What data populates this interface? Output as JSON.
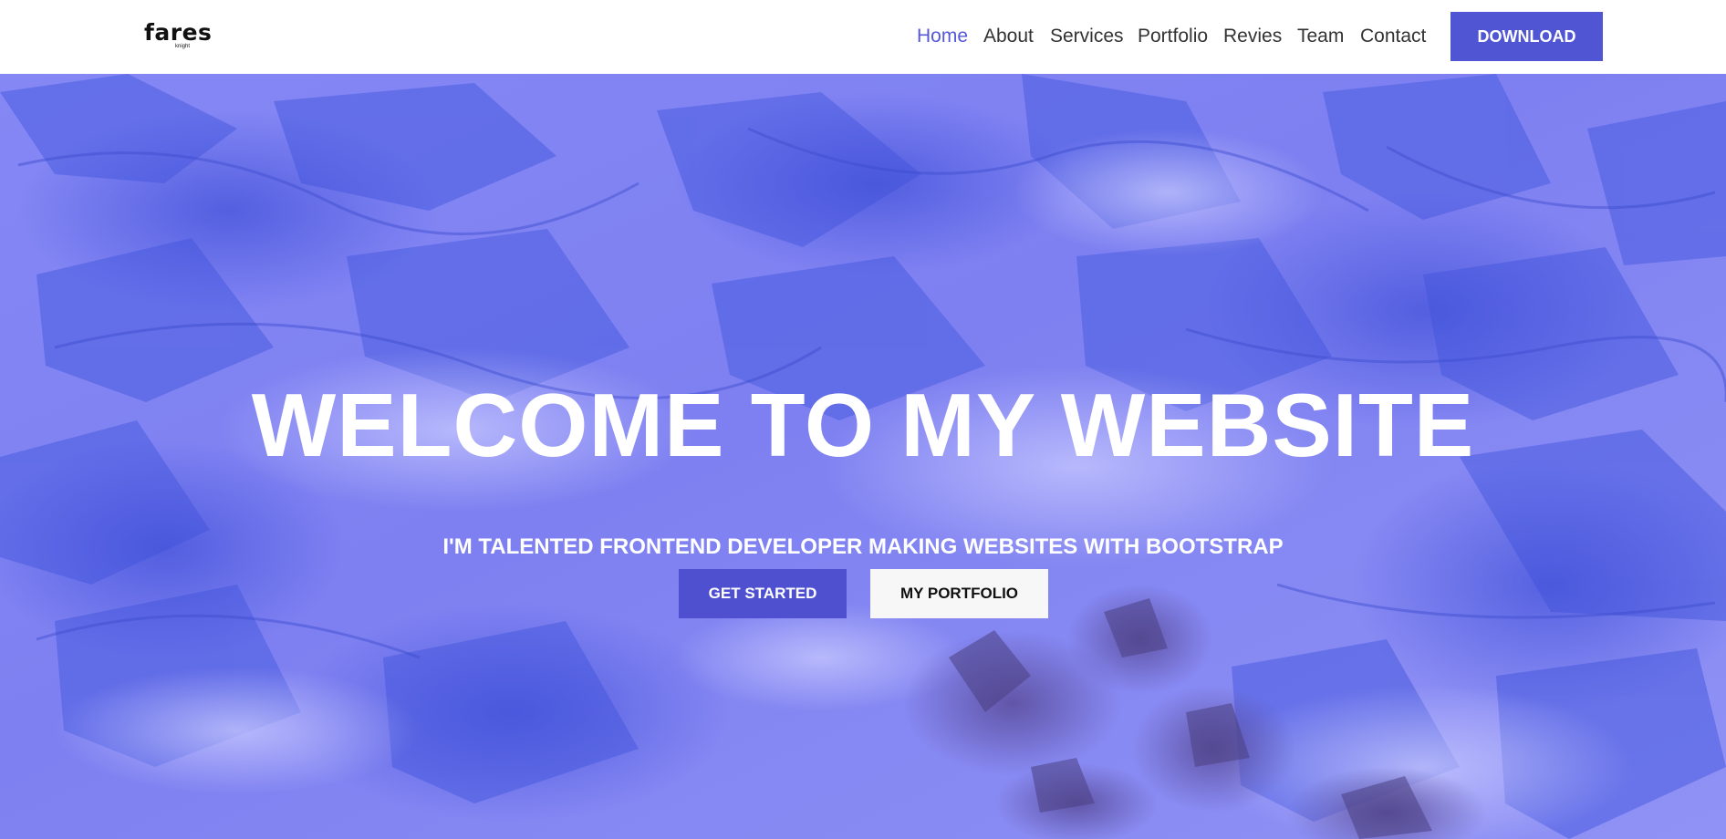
{
  "brand": {
    "name": "fares",
    "tagline": "knight"
  },
  "nav": {
    "items": [
      {
        "label": "Home",
        "active": true
      },
      {
        "label": "About",
        "active": false
      },
      {
        "label": "Services",
        "active": false
      },
      {
        "label": "Portfolio",
        "active": false
      },
      {
        "label": "Revies",
        "active": false
      },
      {
        "label": "Team",
        "active": false
      },
      {
        "label": "Contact",
        "active": false
      }
    ],
    "download_label": "DOWNLOAD"
  },
  "hero": {
    "title": "WELCOME TO MY WEBSITE",
    "subtitle": "I'M TALENTED FRONTEND DEVELOPER MAKING WEBSITES WITH BOOTSTRAP",
    "primary_button": "GET STARTED",
    "secondary_button": "MY PORTFOLIO",
    "background_image": "blue-tinted-glacier-photo"
  },
  "colors": {
    "accent": "#5055d4",
    "nav_active": "#5558d8",
    "nav_text": "#333333",
    "hero_tint": "#7d7ff2",
    "primary_button": "#4f50d0",
    "secondary_button": "#f7f7f8"
  }
}
